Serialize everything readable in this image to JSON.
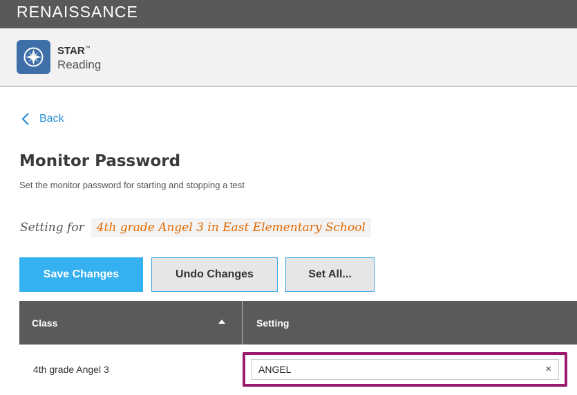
{
  "header": {
    "brand": "RENAISSANCE"
  },
  "app": {
    "name": "STAR",
    "trademark": "™",
    "subtitle": "Reading",
    "icon": "compass-icon",
    "accent": "#3e6fa8"
  },
  "nav": {
    "back_label": "Back",
    "back_icon": "chevron-left-icon"
  },
  "page": {
    "title": "Monitor Password",
    "description": "Set the monitor password for starting and stopping a test",
    "setting_for_label": "Setting for",
    "setting_for_value": "4th grade Angel 3 in East Elementary School"
  },
  "toolbar": {
    "save_label": "Save Changes",
    "undo_label": "Undo Changes",
    "set_all_label": "Set All..."
  },
  "table": {
    "columns": [
      "Class",
      "Setting"
    ],
    "sort_icon": "sort-ascending-icon",
    "rows": [
      {
        "class": "4th grade Angel 3",
        "setting": "ANGEL",
        "clear_label": "×"
      }
    ]
  },
  "colors": {
    "primary": "#35b0f0",
    "highlight_border": "#9b1b6f",
    "setting_value": "#e46a00",
    "header_bg": "#595959"
  }
}
